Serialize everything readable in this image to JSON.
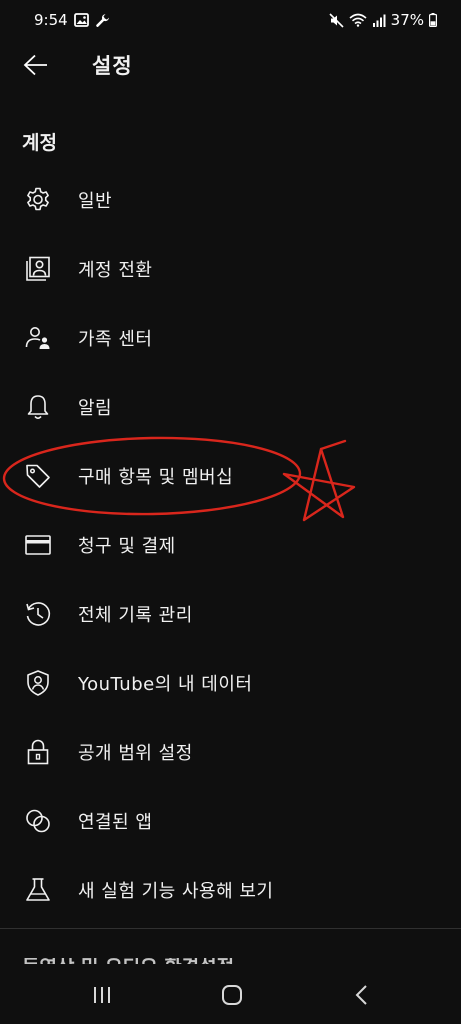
{
  "status_bar": {
    "time": "9:54",
    "battery": "37%",
    "left_icons": [
      "gallery-icon",
      "wrench-icon"
    ],
    "right_icons": [
      "mute-icon",
      "wifi-icon",
      "signal-icon",
      "battery-icon"
    ]
  },
  "header": {
    "title": "설정"
  },
  "section": {
    "title": "계정"
  },
  "menu": {
    "items": [
      {
        "label": "일반",
        "icon": "gear-icon"
      },
      {
        "label": "계정 전환",
        "icon": "account-switch-icon"
      },
      {
        "label": "가족 센터",
        "icon": "family-icon"
      },
      {
        "label": "알림",
        "icon": "bell-icon"
      },
      {
        "label": "구매 항목 및 멤버십",
        "icon": "tag-icon"
      },
      {
        "label": "청구 및 결제",
        "icon": "credit-card-icon"
      },
      {
        "label": "전체 기록 관리",
        "icon": "history-icon"
      },
      {
        "label": "YouTube의 내 데이터",
        "icon": "shield-person-icon"
      },
      {
        "label": "공개 범위 설정",
        "icon": "lock-icon"
      },
      {
        "label": "연결된 앱",
        "icon": "linked-circles-icon"
      },
      {
        "label": "새 실험 기능 사용해 보기",
        "icon": "flask-icon"
      }
    ]
  },
  "cut_off_text": "동영상 및 오디오 환경설정",
  "annotation_color": "#d9261c",
  "nav_bar": {
    "icons": [
      "recent-apps-icon",
      "home-icon",
      "back-nav-icon"
    ]
  }
}
